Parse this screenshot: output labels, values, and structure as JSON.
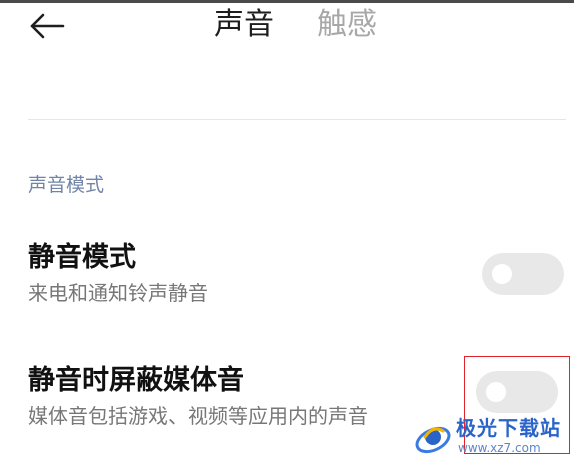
{
  "header": {
    "tabs": [
      {
        "label": "声音",
        "active": true
      },
      {
        "label": "触感",
        "active": false
      }
    ]
  },
  "section": {
    "title": "声音模式"
  },
  "settings": [
    {
      "title": "静音模式",
      "subtitle": "来电和通知铃声静音",
      "enabled": false
    },
    {
      "title": "静音时屏蔽媒体音",
      "subtitle": "媒体音包括游戏、视频等应用内的声音",
      "enabled": false
    }
  ],
  "watermark": {
    "name": "极光下载站",
    "domain": "www.xz7.com"
  },
  "colors": {
    "section_title": "#7184a8",
    "toggle_off": "#e8e8e8",
    "highlight_box": "#e0232b",
    "watermark": "#2a64c8"
  },
  "icons": {
    "back": "arrow-left-icon",
    "watermark_logo": "aurora-logo-icon"
  }
}
